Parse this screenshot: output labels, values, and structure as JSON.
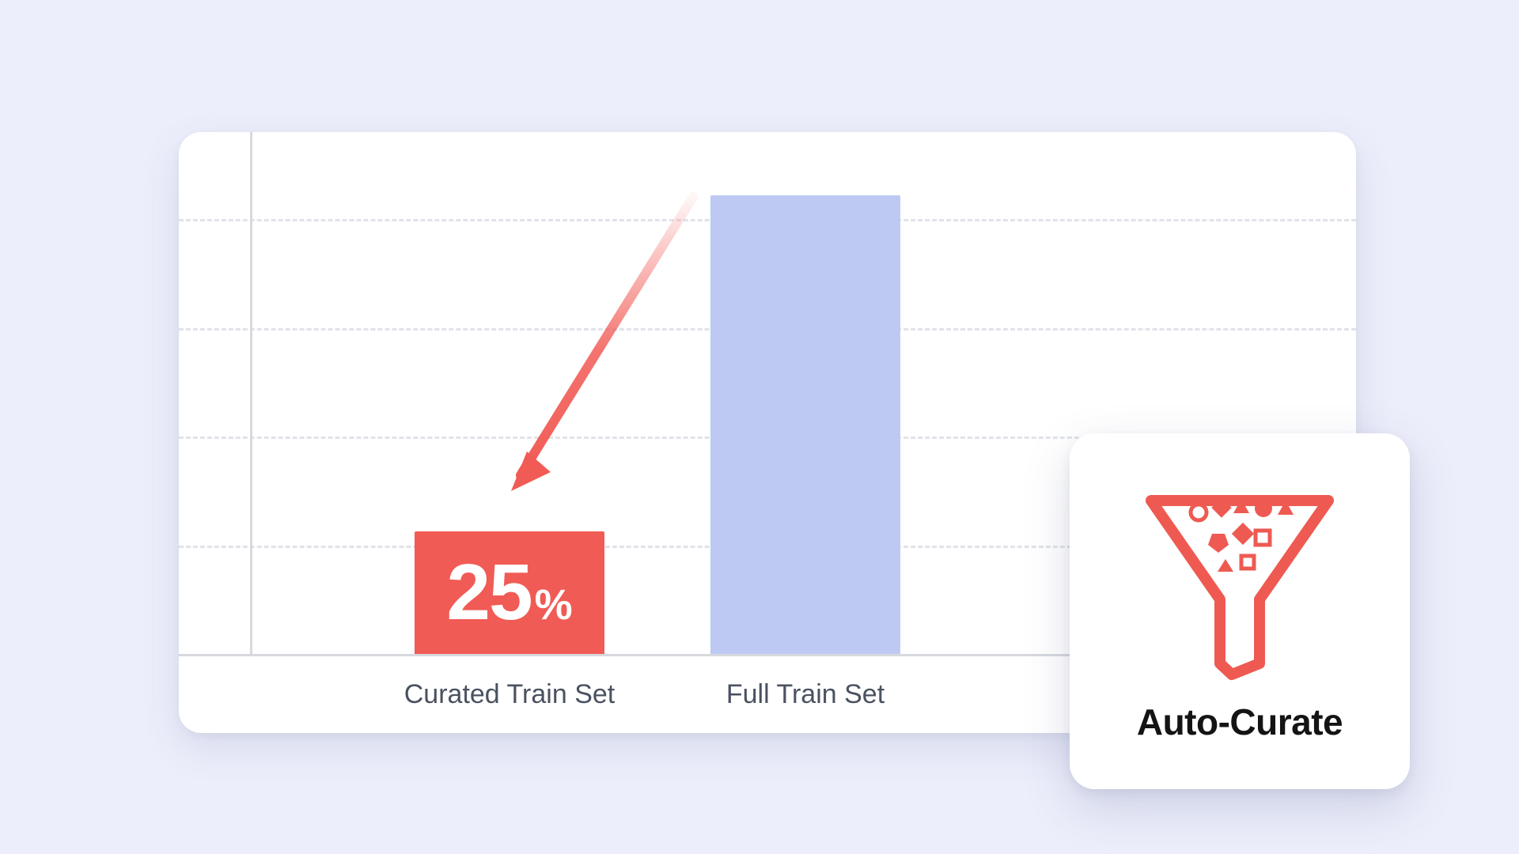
{
  "chart_data": {
    "type": "bar",
    "categories": [
      "Curated Train Set",
      "Full Train Set"
    ],
    "values": [
      25,
      100
    ],
    "value_labels": [
      "25%",
      ""
    ],
    "ylim": [
      0,
      120
    ],
    "gridlines": [
      25,
      50,
      75,
      100
    ],
    "colors": {
      "curated": "#f15b55",
      "full": "#bec9f3"
    },
    "annotation": {
      "arrow_from_bar": "Full Train Set",
      "arrow_to_bar": "Curated Train Set",
      "label_on_bar": "25%"
    }
  },
  "bar_curated_value": "25",
  "bar_curated_unit": "%",
  "category_curated": "Curated Train Set",
  "category_full": "Full Train Set",
  "callout": {
    "label": "Auto-Curate"
  }
}
